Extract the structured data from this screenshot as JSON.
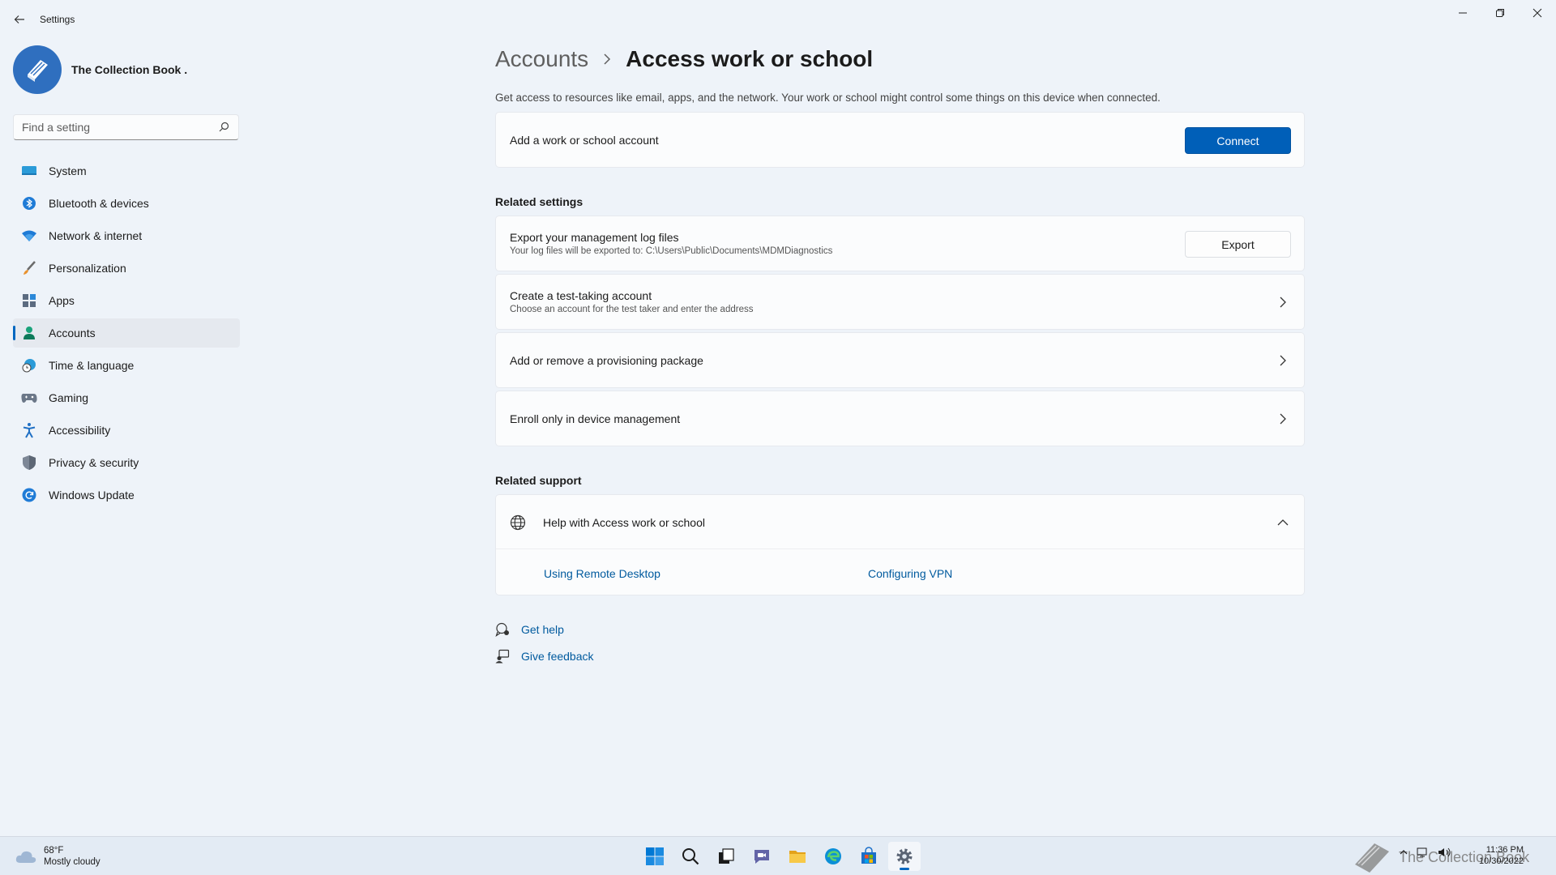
{
  "window": {
    "title": "Settings"
  },
  "profile": {
    "name": "The Collection Book ."
  },
  "search": {
    "placeholder": "Find a setting"
  },
  "sidebar": {
    "items": [
      {
        "label": "System",
        "icon": "monitor-icon"
      },
      {
        "label": "Bluetooth & devices",
        "icon": "bluetooth-icon"
      },
      {
        "label": "Network & internet",
        "icon": "wifi-icon"
      },
      {
        "label": "Personalization",
        "icon": "brush-icon"
      },
      {
        "label": "Apps",
        "icon": "apps-icon"
      },
      {
        "label": "Accounts",
        "icon": "person-icon",
        "active": true
      },
      {
        "label": "Time & language",
        "icon": "globe-clock-icon"
      },
      {
        "label": "Gaming",
        "icon": "gamepad-icon"
      },
      {
        "label": "Accessibility",
        "icon": "accessibility-icon"
      },
      {
        "label": "Privacy & security",
        "icon": "shield-icon"
      },
      {
        "label": "Windows Update",
        "icon": "update-icon"
      }
    ]
  },
  "main": {
    "breadcrumb_parent": "Accounts",
    "breadcrumb_current": "Access work or school",
    "description": "Get access to resources like email, apps, and the network. Your work or school might control some things on this device when connected.",
    "add_account": {
      "title": "Add a work or school account",
      "button": "Connect"
    },
    "related_settings_heading": "Related settings",
    "export_logs": {
      "title": "Export your management log files",
      "subtitle": "Your log files will be exported to: C:\\Users\\Public\\Documents\\MDMDiagnostics",
      "button": "Export"
    },
    "test_account": {
      "title": "Create a test-taking account",
      "subtitle": "Choose an account for the test taker and enter the address"
    },
    "provisioning": {
      "title": "Add or remove a provisioning package"
    },
    "enroll": {
      "title": "Enroll only in device management"
    },
    "related_support_heading": "Related support",
    "help": {
      "title": "Help with Access work or school",
      "links": [
        "Using Remote Desktop",
        "Configuring VPN"
      ]
    },
    "get_help": "Get help",
    "give_feedback": "Give feedback"
  },
  "taskbar": {
    "temperature": "68°F",
    "condition": "Mostly cloudy",
    "time": "11:36 PM",
    "date": "10/30/2022",
    "watermark": "The Collection Book",
    "apps": [
      "start-icon",
      "search-icon",
      "task-view-icon",
      "chat-icon",
      "file-explorer-icon",
      "edge-icon",
      "store-icon",
      "settings-icon"
    ],
    "accent": "#0067c0"
  }
}
